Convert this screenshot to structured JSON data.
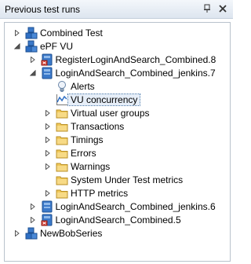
{
  "panel": {
    "title": "Previous test runs",
    "pin_icon": "pin-icon",
    "close_icon": "close-icon"
  },
  "tree": {
    "items": [
      {
        "label": "Combined Test",
        "icon": "blocks-icon",
        "expander": "collapsed"
      },
      {
        "label": "ePF VU",
        "icon": "blocks-icon",
        "expander": "expanded"
      },
      {
        "label": "RegisterLoginAndSearch_Combined.8",
        "icon": "run-error-icon",
        "expander": "collapsed"
      },
      {
        "label": "LoginAndSearch_Combined_jenkins.7",
        "icon": "run-icon",
        "expander": "expanded"
      },
      {
        "label": "Alerts",
        "icon": "lightbulb-icon",
        "expander": "none"
      },
      {
        "label": "VU concurrency",
        "icon": "chart-icon",
        "expander": "none",
        "selected": true
      },
      {
        "label": "Virtual user groups",
        "icon": "folder-icon",
        "expander": "collapsed"
      },
      {
        "label": "Transactions",
        "icon": "folder-icon",
        "expander": "collapsed"
      },
      {
        "label": "Timings",
        "icon": "folder-icon",
        "expander": "collapsed"
      },
      {
        "label": "Errors",
        "icon": "folder-icon",
        "expander": "collapsed"
      },
      {
        "label": "Warnings",
        "icon": "folder-icon",
        "expander": "collapsed"
      },
      {
        "label": "System Under Test metrics",
        "icon": "folder-icon",
        "expander": "none"
      },
      {
        "label": "HTTP metrics",
        "icon": "folder-icon",
        "expander": "collapsed"
      },
      {
        "label": "LoginAndSearch_Combined_jenkins.6",
        "icon": "run-icon",
        "expander": "collapsed"
      },
      {
        "label": "LoginAndSearch_Combined.5",
        "icon": "run-error-icon",
        "expander": "collapsed"
      },
      {
        "label": "NewBobSeries",
        "icon": "blocks-icon",
        "expander": "collapsed"
      }
    ]
  },
  "colors": {
    "titlebar_bg": "#dde5ef",
    "selection_outline": "#3a6ea5",
    "folder": "#f0c85a",
    "blue": "#2f6fc4",
    "error_red": "#d63a2e"
  }
}
